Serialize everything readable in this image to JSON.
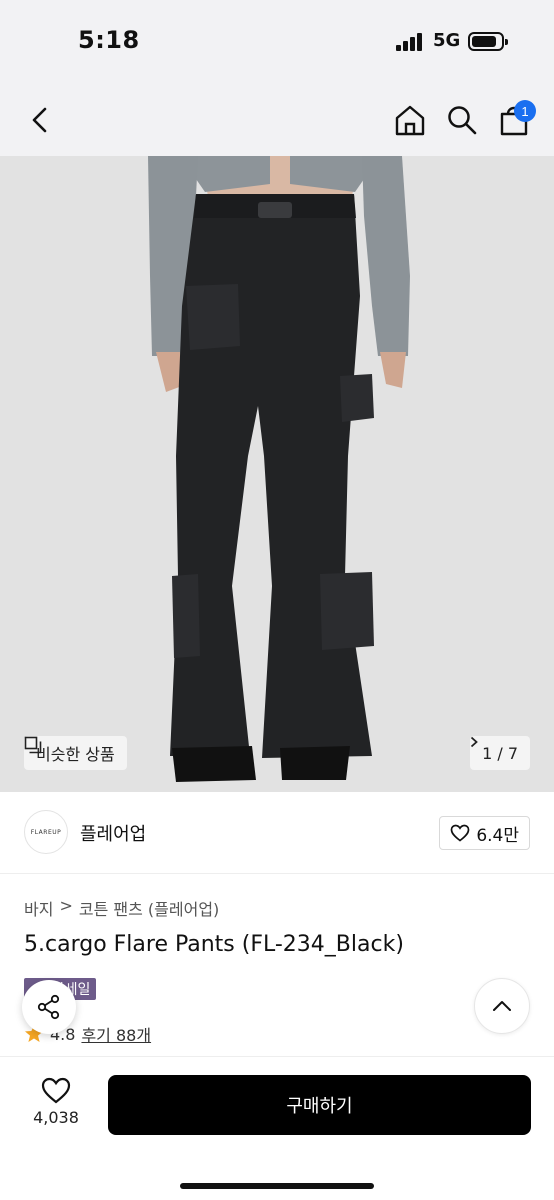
{
  "status_bar": {
    "time": "5:18",
    "network": "5G"
  },
  "header": {
    "cart_count": "1"
  },
  "image": {
    "similar_label": "비슷한 상품",
    "pager": "1 / 7"
  },
  "brand": {
    "logo_text": "FLAREUP",
    "name": "플레어업",
    "likes": "6.4만"
  },
  "product": {
    "breadcrumb": [
      "바지",
      "코튼 팬츠 (플레어업)"
    ],
    "breadcrumb_sep": ">",
    "title": "5.cargo Flare Pants (FL-234_Black)",
    "badge": "상세일",
    "rating": "4.8",
    "review_link": "후기 88개"
  },
  "bottom": {
    "wish_count": "4,038",
    "buy_label": "구매하기"
  },
  "colors": {
    "badge": "#1a6ff0",
    "buy_button": "#000000",
    "star": "#f5a623"
  }
}
